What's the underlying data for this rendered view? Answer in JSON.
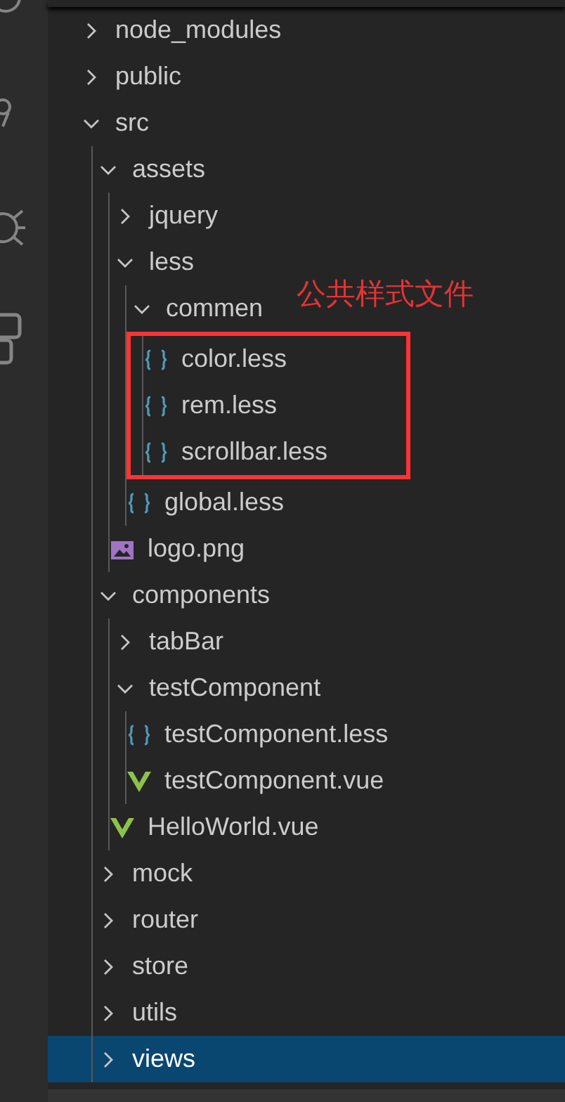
{
  "tree": [
    {
      "kind": "folder",
      "name": "node_modules",
      "expanded": false,
      "selected": false
    },
    {
      "kind": "folder",
      "name": "public",
      "expanded": false,
      "selected": false
    },
    {
      "kind": "folder",
      "name": "src",
      "expanded": true,
      "selected": false,
      "children": [
        {
          "kind": "folder",
          "name": "assets",
          "expanded": true,
          "selected": false,
          "children": [
            {
              "kind": "folder",
              "name": "jquery",
              "expanded": false,
              "selected": false
            },
            {
              "kind": "folder",
              "name": "less",
              "expanded": true,
              "selected": false,
              "children": [
                {
                  "kind": "folder",
                  "name": "commen",
                  "expanded": true,
                  "selected": false,
                  "annotation": "公共样式文件",
                  "children": [
                    {
                      "kind": "less",
                      "name": "color.less",
                      "selected": false
                    },
                    {
                      "kind": "less",
                      "name": "rem.less",
                      "selected": false
                    },
                    {
                      "kind": "less",
                      "name": "scrollbar.less",
                      "selected": false
                    }
                  ]
                },
                {
                  "kind": "less",
                  "name": "global.less",
                  "selected": false
                }
              ]
            },
            {
              "kind": "image",
              "name": "logo.png",
              "selected": false
            }
          ]
        },
        {
          "kind": "folder",
          "name": "components",
          "expanded": true,
          "selected": false,
          "children": [
            {
              "kind": "folder",
              "name": "tabBar",
              "expanded": false,
              "selected": false
            },
            {
              "kind": "folder",
              "name": "testComponent",
              "expanded": true,
              "selected": false,
              "children": [
                {
                  "kind": "less",
                  "name": "testComponent.less",
                  "selected": false
                },
                {
                  "kind": "vue",
                  "name": "testComponent.vue",
                  "selected": false
                }
              ]
            },
            {
              "kind": "vue",
              "name": "HelloWorld.vue",
              "selected": false
            }
          ]
        },
        {
          "kind": "folder",
          "name": "mock",
          "expanded": false,
          "selected": false
        },
        {
          "kind": "folder",
          "name": "router",
          "expanded": false,
          "selected": false
        },
        {
          "kind": "folder",
          "name": "store",
          "expanded": false,
          "selected": false
        },
        {
          "kind": "folder",
          "name": "utils",
          "expanded": false,
          "selected": false
        },
        {
          "kind": "folder",
          "name": "views",
          "expanded": false,
          "selected": true
        }
      ]
    }
  ]
}
